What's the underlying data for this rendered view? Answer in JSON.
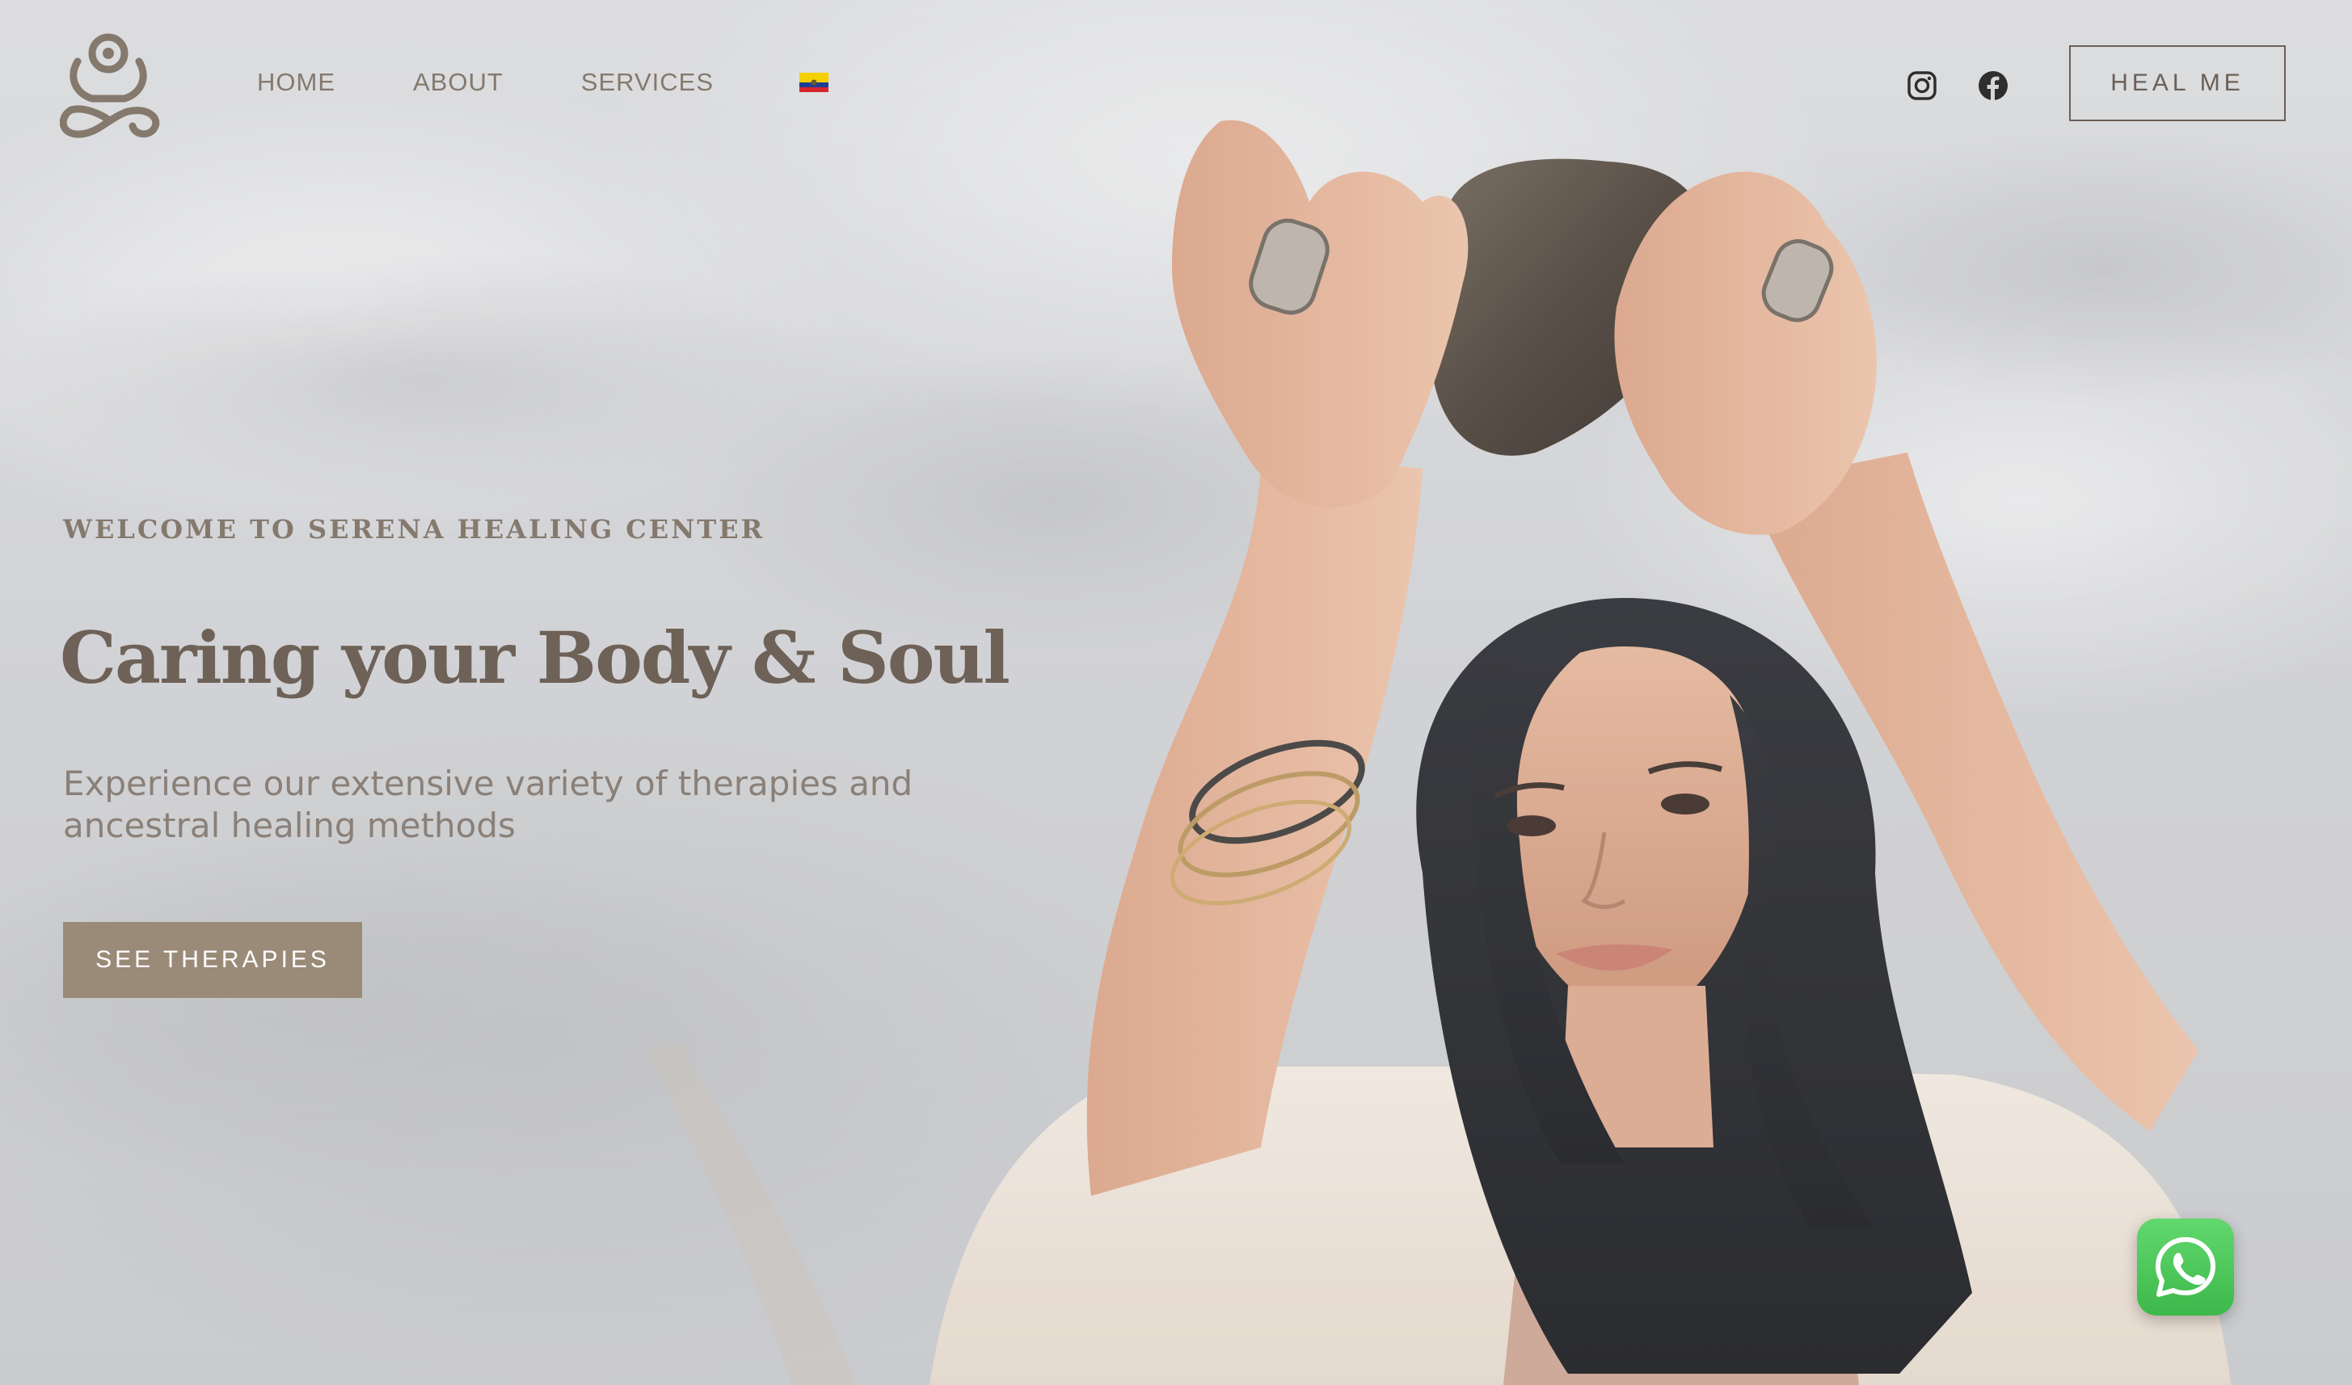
{
  "brand": {
    "logo": "meditating-figure-logo-icon",
    "colors": {
      "primary_text": "#6e6157",
      "nav_text": "#85796d",
      "cta_background": "#9a8a78",
      "cta_text": "#ffffff",
      "whatsapp_green": "#3db84a"
    }
  },
  "nav": {
    "items": [
      {
        "label": "HOME"
      },
      {
        "label": "ABOUT"
      },
      {
        "label": "SERVICES"
      }
    ],
    "language_flag": "ecuador-flag-icon"
  },
  "social": {
    "instagram": "instagram-icon",
    "facebook": "facebook-icon"
  },
  "header_button": {
    "label": "HEAL ME"
  },
  "hero": {
    "welcome": "WELCOME TO SERENA HEALING CENTER",
    "headline": "Caring your Body & Soul",
    "subtitle": "Experience our extensive variety of therapies and ancestral healing methods",
    "cta_label": "SEE THERAPIES"
  },
  "floating": {
    "whatsapp": "whatsapp-icon"
  }
}
